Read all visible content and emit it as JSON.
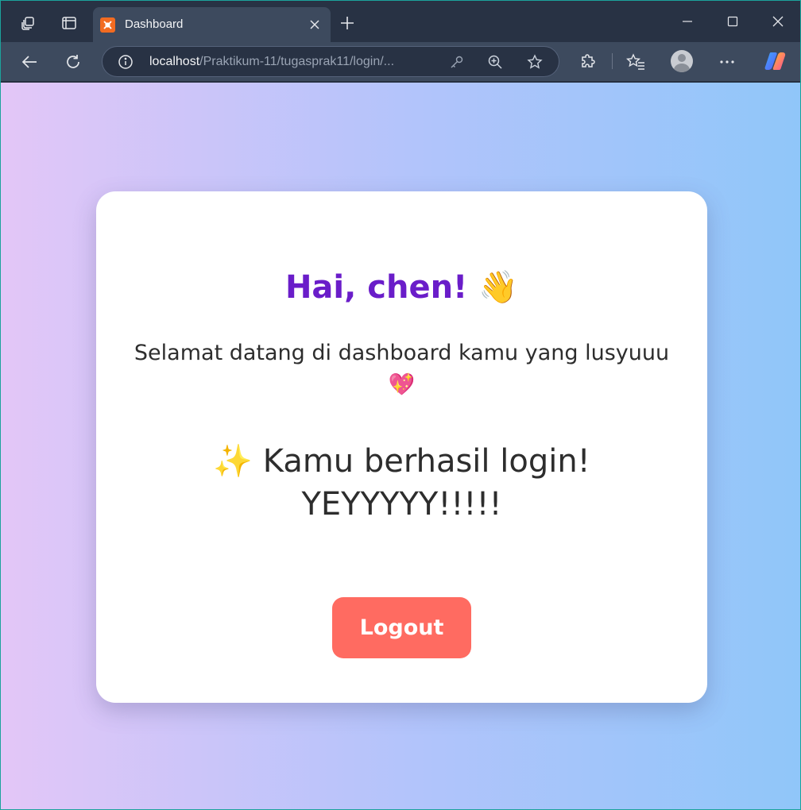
{
  "browser": {
    "tab_title": "Dashboard",
    "address": {
      "host": "localhost",
      "path": "/Praktikum-11/tugasprak11/login/..."
    },
    "icons": {
      "workspaces": "workspaces-icon",
      "tab_actions": "tab-actions-icon",
      "favicon": "xampp-favicon-icon",
      "close_tab": "close-icon",
      "new_tab": "plus-icon",
      "minimize": "minimize-icon",
      "maximize": "maximize-icon",
      "close_window": "close-icon",
      "back": "back-arrow-icon",
      "refresh": "refresh-icon",
      "site_info": "info-icon",
      "key": "key-icon",
      "zoom": "zoom-in-icon",
      "favorite": "star-icon",
      "extensions": "puzzle-icon",
      "favorites": "favorites-icon",
      "profile": "profile-icon",
      "more": "more-icon",
      "copilot": "copilot-icon"
    }
  },
  "page": {
    "greeting": "Hai, chen!",
    "greeting_emoji": "👋",
    "subtitle": "Selamat datang di dashboard kamu yang lusyuuu 💖",
    "success_message": "✨ Kamu berhasil login! YEYYYYY!!!!!",
    "logout_label": "Logout"
  },
  "colors": {
    "greeting": "#6a1dc9",
    "logout_button": "#ff6b61",
    "background_left": "#e3c6f7",
    "background_right": "#90c6f9"
  }
}
